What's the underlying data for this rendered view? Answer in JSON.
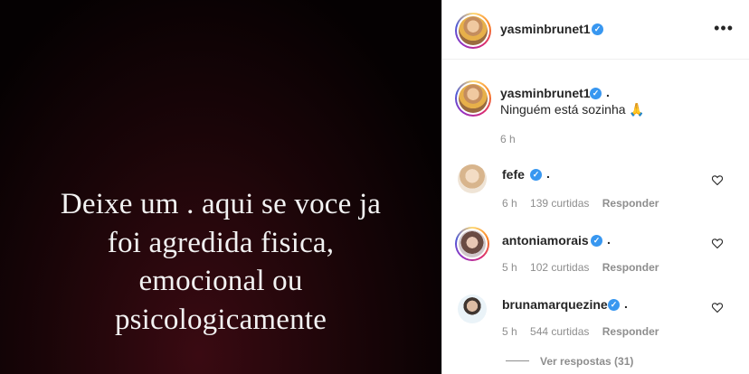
{
  "post": {
    "lines": [
      "Deixe um . aqui se voce ja",
      "foi agredida fisica,",
      "emocional ou",
      "psicologicamente"
    ]
  },
  "header": {
    "username": "yasminbrunet1",
    "more_label": "•••"
  },
  "caption": {
    "username": "yasminbrunet1",
    "dot": ".",
    "text": "Ninguém está sozinha 🙏",
    "time": "6 h"
  },
  "comments": [
    {
      "username": "fefe",
      "dot": ".",
      "time": "6 h",
      "likes": "139 curtidas",
      "reply": "Responder"
    },
    {
      "username": "antoniamorais",
      "dot": ".",
      "time": "5 h",
      "likes": "102 curtidas",
      "reply": "Responder"
    },
    {
      "username": "brunamarquezine",
      "dot": ".",
      "time": "5 h",
      "likes": "544 curtidas",
      "reply": "Responder"
    }
  ],
  "view_replies": "Ver respostas (31)",
  "icons": {
    "verified": "verified-badge-icon",
    "heart": "heart-icon",
    "more": "more-options-icon"
  },
  "colors": {
    "verified": "#3897f0",
    "text": "#262626",
    "muted": "#8e8e8e"
  }
}
